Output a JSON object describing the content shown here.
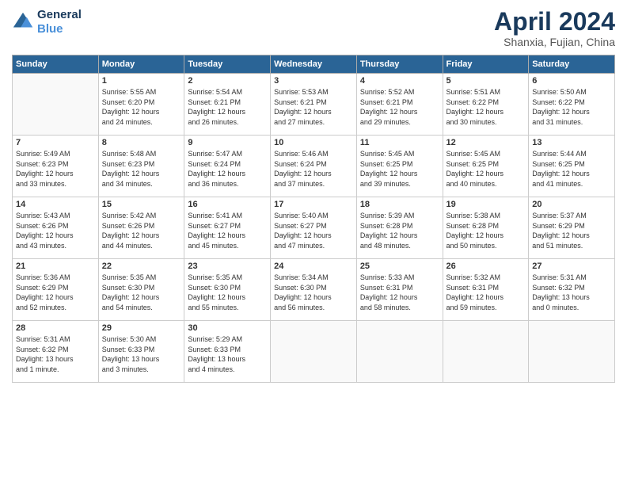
{
  "header": {
    "logo_line1": "General",
    "logo_line2": "Blue",
    "month_title": "April 2024",
    "location": "Shanxia, Fujian, China"
  },
  "days_of_week": [
    "Sunday",
    "Monday",
    "Tuesday",
    "Wednesday",
    "Thursday",
    "Friday",
    "Saturday"
  ],
  "weeks": [
    [
      {
        "day": "",
        "info": ""
      },
      {
        "day": "1",
        "info": "Sunrise: 5:55 AM\nSunset: 6:20 PM\nDaylight: 12 hours\nand 24 minutes."
      },
      {
        "day": "2",
        "info": "Sunrise: 5:54 AM\nSunset: 6:21 PM\nDaylight: 12 hours\nand 26 minutes."
      },
      {
        "day": "3",
        "info": "Sunrise: 5:53 AM\nSunset: 6:21 PM\nDaylight: 12 hours\nand 27 minutes."
      },
      {
        "day": "4",
        "info": "Sunrise: 5:52 AM\nSunset: 6:21 PM\nDaylight: 12 hours\nand 29 minutes."
      },
      {
        "day": "5",
        "info": "Sunrise: 5:51 AM\nSunset: 6:22 PM\nDaylight: 12 hours\nand 30 minutes."
      },
      {
        "day": "6",
        "info": "Sunrise: 5:50 AM\nSunset: 6:22 PM\nDaylight: 12 hours\nand 31 minutes."
      }
    ],
    [
      {
        "day": "7",
        "info": "Sunrise: 5:49 AM\nSunset: 6:23 PM\nDaylight: 12 hours\nand 33 minutes."
      },
      {
        "day": "8",
        "info": "Sunrise: 5:48 AM\nSunset: 6:23 PM\nDaylight: 12 hours\nand 34 minutes."
      },
      {
        "day": "9",
        "info": "Sunrise: 5:47 AM\nSunset: 6:24 PM\nDaylight: 12 hours\nand 36 minutes."
      },
      {
        "day": "10",
        "info": "Sunrise: 5:46 AM\nSunset: 6:24 PM\nDaylight: 12 hours\nand 37 minutes."
      },
      {
        "day": "11",
        "info": "Sunrise: 5:45 AM\nSunset: 6:25 PM\nDaylight: 12 hours\nand 39 minutes."
      },
      {
        "day": "12",
        "info": "Sunrise: 5:45 AM\nSunset: 6:25 PM\nDaylight: 12 hours\nand 40 minutes."
      },
      {
        "day": "13",
        "info": "Sunrise: 5:44 AM\nSunset: 6:25 PM\nDaylight: 12 hours\nand 41 minutes."
      }
    ],
    [
      {
        "day": "14",
        "info": "Sunrise: 5:43 AM\nSunset: 6:26 PM\nDaylight: 12 hours\nand 43 minutes."
      },
      {
        "day": "15",
        "info": "Sunrise: 5:42 AM\nSunset: 6:26 PM\nDaylight: 12 hours\nand 44 minutes."
      },
      {
        "day": "16",
        "info": "Sunrise: 5:41 AM\nSunset: 6:27 PM\nDaylight: 12 hours\nand 45 minutes."
      },
      {
        "day": "17",
        "info": "Sunrise: 5:40 AM\nSunset: 6:27 PM\nDaylight: 12 hours\nand 47 minutes."
      },
      {
        "day": "18",
        "info": "Sunrise: 5:39 AM\nSunset: 6:28 PM\nDaylight: 12 hours\nand 48 minutes."
      },
      {
        "day": "19",
        "info": "Sunrise: 5:38 AM\nSunset: 6:28 PM\nDaylight: 12 hours\nand 50 minutes."
      },
      {
        "day": "20",
        "info": "Sunrise: 5:37 AM\nSunset: 6:29 PM\nDaylight: 12 hours\nand 51 minutes."
      }
    ],
    [
      {
        "day": "21",
        "info": "Sunrise: 5:36 AM\nSunset: 6:29 PM\nDaylight: 12 hours\nand 52 minutes."
      },
      {
        "day": "22",
        "info": "Sunrise: 5:35 AM\nSunset: 6:30 PM\nDaylight: 12 hours\nand 54 minutes."
      },
      {
        "day": "23",
        "info": "Sunrise: 5:35 AM\nSunset: 6:30 PM\nDaylight: 12 hours\nand 55 minutes."
      },
      {
        "day": "24",
        "info": "Sunrise: 5:34 AM\nSunset: 6:30 PM\nDaylight: 12 hours\nand 56 minutes."
      },
      {
        "day": "25",
        "info": "Sunrise: 5:33 AM\nSunset: 6:31 PM\nDaylight: 12 hours\nand 58 minutes."
      },
      {
        "day": "26",
        "info": "Sunrise: 5:32 AM\nSunset: 6:31 PM\nDaylight: 12 hours\nand 59 minutes."
      },
      {
        "day": "27",
        "info": "Sunrise: 5:31 AM\nSunset: 6:32 PM\nDaylight: 13 hours\nand 0 minutes."
      }
    ],
    [
      {
        "day": "28",
        "info": "Sunrise: 5:31 AM\nSunset: 6:32 PM\nDaylight: 13 hours\nand 1 minute."
      },
      {
        "day": "29",
        "info": "Sunrise: 5:30 AM\nSunset: 6:33 PM\nDaylight: 13 hours\nand 3 minutes."
      },
      {
        "day": "30",
        "info": "Sunrise: 5:29 AM\nSunset: 6:33 PM\nDaylight: 13 hours\nand 4 minutes."
      },
      {
        "day": "",
        "info": ""
      },
      {
        "day": "",
        "info": ""
      },
      {
        "day": "",
        "info": ""
      },
      {
        "day": "",
        "info": ""
      }
    ]
  ]
}
